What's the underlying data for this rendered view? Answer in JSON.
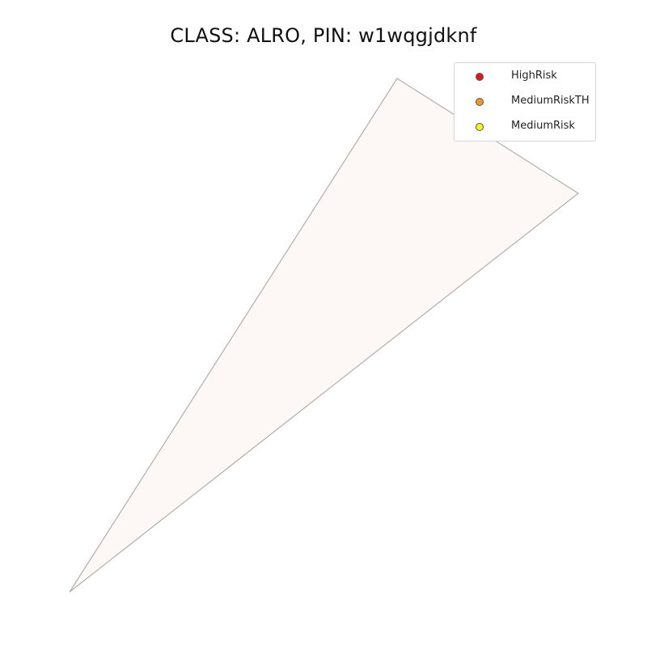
{
  "title": "CLASS: ALRO, PIN: w1wqgjdknf",
  "legend": {
    "items": [
      {
        "label": "HighRisk",
        "color": "#e01a1a"
      },
      {
        "label": "MediumRiskTH",
        "color": "#f0962a"
      },
      {
        "label": "MediumRisk",
        "color": "#f5f516"
      }
    ]
  },
  "parcel": {
    "fill": "#fdf8f5",
    "stroke": "#b3adab"
  }
}
